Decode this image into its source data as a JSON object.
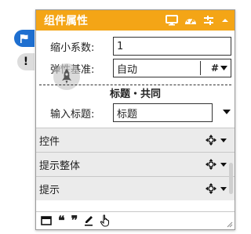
{
  "panel": {
    "title": "组件属性",
    "fields": {
      "scale_label": "缩小系数:",
      "scale_value": "1",
      "baseline_label": "弹性基准:",
      "baseline_value": "自动",
      "baseline_suffix": "#"
    },
    "section": {
      "title": "标题・共同",
      "input_title_label": "输入标题:",
      "input_title_value": "标题"
    },
    "groups": [
      {
        "label": "控件"
      },
      {
        "label": "提示整体"
      },
      {
        "label": "提示"
      }
    ],
    "toolbar": {
      "quote_open": "❝",
      "quote_close": "❞"
    }
  },
  "colors": {
    "title_bar": "#f4a516",
    "active_tab": "#1e6fd0"
  },
  "icons": {
    "side_tabs": [
      "flag-icon",
      "alert-icon"
    ],
    "titlebar": [
      "monitor-icon",
      "dashboard-icon",
      "filter-icon",
      "collapse-icon"
    ]
  }
}
